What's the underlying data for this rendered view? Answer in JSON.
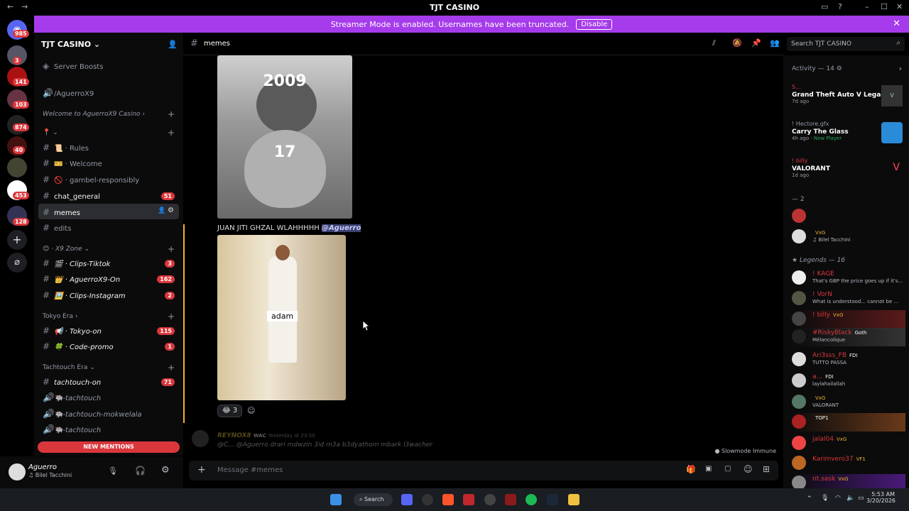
{
  "window": {
    "title": "TJT CASINO"
  },
  "banner": {
    "text": "Streamer Mode is enabled. Usernames have been truncated.",
    "button": "Disable"
  },
  "guilds": {
    "home_badge": "985",
    "badges": [
      "3",
      "141",
      "103",
      "874",
      "40",
      "453",
      "128"
    ]
  },
  "server": {
    "name": "TJT CASINO"
  },
  "sidebar": {
    "boosts": "Server Boosts",
    "voice_top": "/AguerroX9",
    "cat_welcome": "Welcome to AguerroX9 Casino",
    "pin_cat": "📍 ⌄",
    "channels": [
      {
        "label": "📜 · Rules"
      },
      {
        "label": "🎫 · Welcome"
      },
      {
        "label": "🚫 · gambel-responsibly"
      },
      {
        "label": "chat_general",
        "badge": "51"
      },
      {
        "label": "memes"
      },
      {
        "label": "edits"
      }
    ],
    "cat_x9": "X9 Zone",
    "x9_channels": [
      {
        "label": "🎬 · Clips-Tiktok",
        "badge": "3"
      },
      {
        "label": "👑 · AguerroX9-On",
        "badge": "162"
      },
      {
        "label": "🖼️ · Clips-Instagram",
        "badge": "2"
      }
    ],
    "cat_tokyo": "Tokyo Era",
    "tokyo_channels": [
      {
        "label": "📢 · Tokyo-on",
        "badge": "115"
      },
      {
        "label": "🍀 · Code-promo",
        "badge": "1"
      }
    ],
    "cat_tachtouch": "Tachtouch Era",
    "tach_channels": [
      {
        "label": "tachtouch-on",
        "badge": "71"
      },
      {
        "label": "🐃-tachtouch"
      },
      {
        "label": "🐃-tachtouch-mokwelala"
      },
      {
        "label": "🐃-tachtouch"
      }
    ],
    "new_mentions": "NEW MENTIONS"
  },
  "user": {
    "name": "Aguerro",
    "status": "♫ Bilel Tacchini"
  },
  "header": {
    "channel": "memes",
    "search_placeholder": "Search TJT CASINO"
  },
  "chat": {
    "img1_top": "2009",
    "img1_mid": "17",
    "msg2_text": "JUAN JITI GHZAL WLAHHHHH",
    "msg2_mention": "@Aguerro",
    "img2_label": "adam",
    "reaction_emoji": "😂",
    "reaction_count": "3",
    "next_author": "REYNOX8",
    "next_tag": "WAC",
    "next_time": "Yesterday at 23:50",
    "next_preview": "@C... @Aguerro  drari mdwzin 3id m3a b3dyathom mbark l3wacher",
    "slowmode": "Slowmode Immune"
  },
  "composer": {
    "placeholder": "Message #memes"
  },
  "members": {
    "activity_title": "Activity — 14",
    "activities": [
      {
        "user": "S...",
        "game": "Grand Theft Auto V Legacy",
        "meta": "7d ago"
      },
      {
        "user": "! Hectore.gfx",
        "game": "Carry The Glass",
        "meta": "4h ago",
        "meta2": "New Player"
      },
      {
        "user": "! billy",
        "game": "VALORANT",
        "meta": "1d ago"
      }
    ],
    "group1_title": "— 2",
    "group1": [
      {
        "name": "",
        "status": ""
      },
      {
        "name": "VxG",
        "status": "♫ Bilel Tacchini"
      }
    ],
    "legends_title": "Legends — 16",
    "legends": [
      {
        "name": "! KAGE",
        "status": "That's GBP the price goes up if it's..."
      },
      {
        "name": "! VorN",
        "status": "What is understood... cannot be ..."
      },
      {
        "name": "! billy",
        "tag": "VxG",
        "status": ""
      },
      {
        "name": "#RiskyBlack",
        "tag": "Goth",
        "status": "Mélancolique"
      },
      {
        "name": "Ari3sss_FB",
        "tag": "FDI",
        "status": "TUTTO PASSA"
      },
      {
        "name": "a...",
        "tag": "FDI",
        "status": "laylahailallah"
      },
      {
        "name": "",
        "tag": "VxG",
        "status": "VALORANT"
      },
      {
        "name": "",
        "tag": "TOP1",
        "status": ""
      },
      {
        "name": "jalal04",
        "tag": "VxG",
        "status": ""
      },
      {
        "name": "Karimvero37",
        "tag": "VF1",
        "status": ""
      },
      {
        "name": "nt.sask",
        "tag": "VxG",
        "status": ""
      }
    ]
  },
  "taskbar": {
    "search": "Search",
    "time": "5:53 AM",
    "date": "3/20/2026"
  }
}
